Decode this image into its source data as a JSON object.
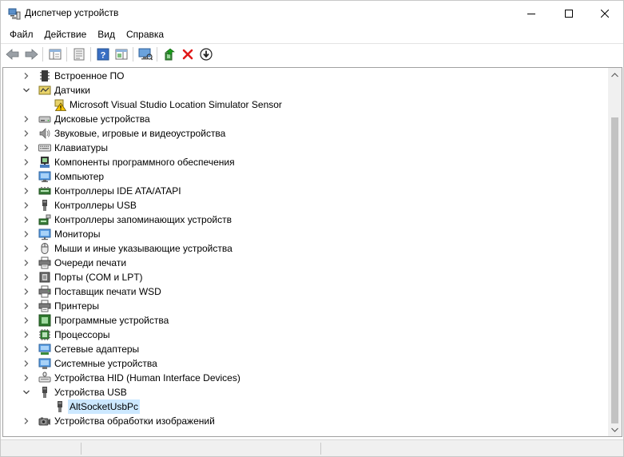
{
  "window": {
    "title": "Диспетчер устройств"
  },
  "menu": [
    {
      "label": "Файл"
    },
    {
      "label": "Действие"
    },
    {
      "label": "Вид"
    },
    {
      "label": "Справка"
    }
  ],
  "tree": [
    {
      "label": "Встроенное ПО",
      "expanded": false,
      "level": 0,
      "icon": "firmware-icon"
    },
    {
      "label": "Датчики",
      "expanded": true,
      "level": 0,
      "icon": "sensor-icon"
    },
    {
      "label": "Microsoft Visual Studio Location Simulator Sensor",
      "level": 1,
      "icon": "sensor-warning-icon"
    },
    {
      "label": "Дисковые устройства",
      "expanded": false,
      "level": 0,
      "icon": "disk-icon"
    },
    {
      "label": "Звуковые, игровые и видеоустройства",
      "expanded": false,
      "level": 0,
      "icon": "speaker-icon"
    },
    {
      "label": "Клавиатуры",
      "expanded": false,
      "level": 0,
      "icon": "keyboard-icon"
    },
    {
      "label": "Компоненты программного обеспечения",
      "expanded": false,
      "level": 0,
      "icon": "software-component-icon"
    },
    {
      "label": "Компьютер",
      "expanded": false,
      "level": 0,
      "icon": "computer-icon"
    },
    {
      "label": "Контроллеры IDE ATA/ATAPI",
      "expanded": false,
      "level": 0,
      "icon": "ide-controller-icon"
    },
    {
      "label": "Контроллеры USB",
      "expanded": false,
      "level": 0,
      "icon": "usb-controller-icon"
    },
    {
      "label": "Контроллеры запоминающих устройств",
      "expanded": false,
      "level": 0,
      "icon": "storage-controller-icon"
    },
    {
      "label": "Мониторы",
      "expanded": false,
      "level": 0,
      "icon": "monitor-icon"
    },
    {
      "label": "Мыши и иные указывающие устройства",
      "expanded": false,
      "level": 0,
      "icon": "mouse-icon"
    },
    {
      "label": "Очереди печати",
      "expanded": false,
      "level": 0,
      "icon": "print-queue-icon"
    },
    {
      "label": "Порты (COM и LPT)",
      "expanded": false,
      "level": 0,
      "icon": "port-icon"
    },
    {
      "label": "Поставщик печати WSD",
      "expanded": false,
      "level": 0,
      "icon": "wsd-printer-icon"
    },
    {
      "label": "Принтеры",
      "expanded": false,
      "level": 0,
      "icon": "printer-icon"
    },
    {
      "label": "Программные устройства",
      "expanded": false,
      "level": 0,
      "icon": "software-device-icon"
    },
    {
      "label": "Процессоры",
      "expanded": false,
      "level": 0,
      "icon": "processor-icon"
    },
    {
      "label": "Сетевые адаптеры",
      "expanded": false,
      "level": 0,
      "icon": "network-adapter-icon"
    },
    {
      "label": "Системные устройства",
      "expanded": false,
      "level": 0,
      "icon": "system-device-icon"
    },
    {
      "label": "Устройства HID (Human Interface Devices)",
      "expanded": false,
      "level": 0,
      "icon": "hid-icon"
    },
    {
      "label": "Устройства USB",
      "expanded": true,
      "level": 0,
      "icon": "usb-device-icon"
    },
    {
      "label": "AltSocketUsbPc",
      "level": 1,
      "icon": "usb-plug-icon",
      "selected": true
    },
    {
      "label": "Устройства обработки изображений",
      "expanded": false,
      "level": 0,
      "icon": "imaging-device-icon"
    }
  ],
  "colors": {
    "selection": "#cce8ff",
    "warning": "#f5c400",
    "delete": "#e01a1a",
    "scroll_thumb": "#c2c2c2"
  }
}
